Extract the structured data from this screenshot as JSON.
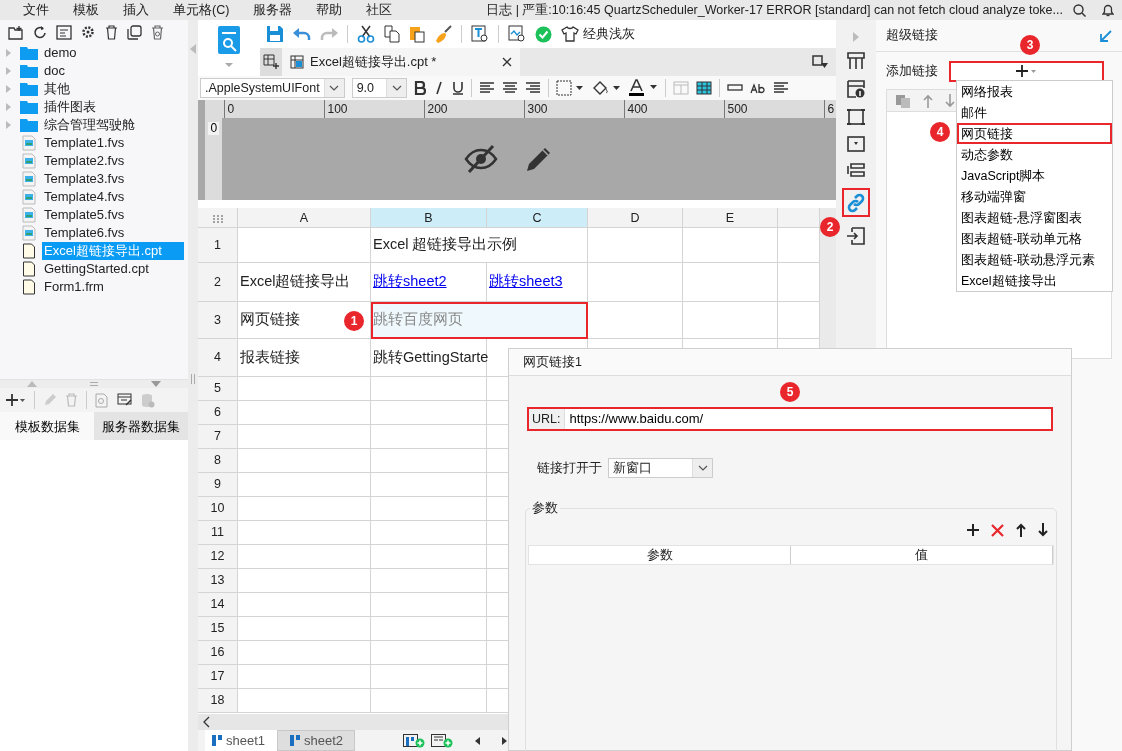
{
  "menu_bar": {
    "items": [
      "文件",
      "模板",
      "插入",
      "单元格(C)",
      "服务器",
      "帮助",
      "社区"
    ],
    "log": "日志 | 严重:10:16:45 QuartzScheduler_Worker-17 ERROR [standard] can not fetch cloud analyze toke..."
  },
  "file_tree": [
    {
      "label": "demo",
      "kind": "folder",
      "selected": false
    },
    {
      "label": "doc",
      "kind": "folder",
      "selected": false
    },
    {
      "label": "其他",
      "kind": "folder",
      "selected": false
    },
    {
      "label": "插件图表",
      "kind": "folder",
      "selected": false
    },
    {
      "label": "综合管理驾驶舱",
      "kind": "folder",
      "selected": false
    },
    {
      "label": "Template1.fvs",
      "kind": "fvs",
      "selected": false
    },
    {
      "label": "Template2.fvs",
      "kind": "fvs",
      "selected": false
    },
    {
      "label": "Template3.fvs",
      "kind": "fvs",
      "selected": false
    },
    {
      "label": "Template4.fvs",
      "kind": "fvs",
      "selected": false
    },
    {
      "label": "Template5.fvs",
      "kind": "fvs",
      "selected": false
    },
    {
      "label": "Template6.fvs",
      "kind": "fvs",
      "selected": false
    },
    {
      "label": "Excel超链接导出.cpt",
      "kind": "file",
      "selected": true
    },
    {
      "label": "GettingStarted.cpt",
      "kind": "file",
      "selected": false
    },
    {
      "label": "Form1.frm",
      "kind": "file",
      "selected": false
    }
  ],
  "dataset_tabs": [
    {
      "label": "模板数据集",
      "selected": true
    },
    {
      "label": "服务器数据集",
      "selected": false
    }
  ],
  "toolbar": {
    "theme": "经典浅灰"
  },
  "document_tab": {
    "label": "Excel超链接导出.cpt *"
  },
  "format_bar": {
    "font": ".AppleSystemUIFont",
    "size": "9.0"
  },
  "ruler": {
    "vertical": "0",
    "marks": [
      "0",
      "100",
      "200",
      "300",
      "400",
      "500",
      "6"
    ]
  },
  "grid": {
    "columns": [
      {
        "label": "A",
        "selected": false
      },
      {
        "label": "B",
        "selected": true
      },
      {
        "label": "C",
        "selected": true
      },
      {
        "label": "D",
        "selected": false
      },
      {
        "label": "E",
        "selected": false
      }
    ],
    "rows": [
      {
        "label": "1",
        "cells": [
          {
            "kind": "empty",
            "selected": false
          },
          {
            "kind": "text",
            "text": "Excel 超链接导出示例",
            "merged": true,
            "selected": false
          }
        ]
      },
      {
        "label": "2",
        "cells": [
          {
            "kind": "text",
            "text": "Excel超链接导出",
            "selected": false
          },
          {
            "kind": "link",
            "text": "跳转sheet2",
            "selected": false
          },
          {
            "kind": "link",
            "text": "跳转sheet3",
            "selected": false
          }
        ]
      },
      {
        "label": "3",
        "cells": [
          {
            "kind": "text",
            "text": "网页链接",
            "selected": false
          },
          {
            "kind": "hint",
            "text": "跳转百度网页",
            "merged": true,
            "selected": true,
            "annotation": "1"
          }
        ]
      },
      {
        "label": "4",
        "cells": [
          {
            "kind": "text",
            "text": "报表链接",
            "selected": false
          },
          {
            "kind": "text",
            "text": "跳转GettingStarte",
            "selected": false
          }
        ]
      },
      {
        "label": "5"
      },
      {
        "label": "6"
      },
      {
        "label": "7"
      },
      {
        "label": "8"
      },
      {
        "label": "9"
      },
      {
        "label": "10"
      },
      {
        "label": "11"
      },
      {
        "label": "12"
      },
      {
        "label": "13"
      },
      {
        "label": "14"
      },
      {
        "label": "15"
      },
      {
        "label": "16"
      },
      {
        "label": "17"
      },
      {
        "label": "18"
      }
    ]
  },
  "sheet_tabs": [
    {
      "label": "sheet1",
      "selected": true
    },
    {
      "label": "sheet2",
      "selected": false
    }
  ],
  "side_toolbar": {
    "link_annotation": "2"
  },
  "hyperlink_panel": {
    "title": "超级链接",
    "add_label": "添加链接",
    "add_annotation": "3",
    "menu": [
      {
        "label": "网络报表",
        "highlighted": false
      },
      {
        "label": "邮件",
        "highlighted": false
      },
      {
        "label": "网页链接",
        "highlighted": true,
        "annotation": "4"
      },
      {
        "label": "动态参数",
        "highlighted": false
      },
      {
        "label": "JavaScript脚本",
        "highlighted": false
      },
      {
        "label": "移动端弹窗",
        "highlighted": false
      },
      {
        "label": "图表超链-悬浮窗图表",
        "highlighted": false
      },
      {
        "label": "图表超链-联动单元格",
        "highlighted": false
      },
      {
        "label": "图表超链-联动悬浮元素",
        "highlighted": false
      },
      {
        "label": "Excel超链接导出",
        "highlighted": false
      }
    ]
  },
  "dialog": {
    "title": "网页链接1",
    "url_label": "URL:",
    "url": "https://www.baidu.com/",
    "url_annotation": "5",
    "open_in_label": "链接打开于",
    "open_in": "新窗口",
    "params_legend": "参数",
    "columns": [
      "参数",
      "值"
    ]
  }
}
